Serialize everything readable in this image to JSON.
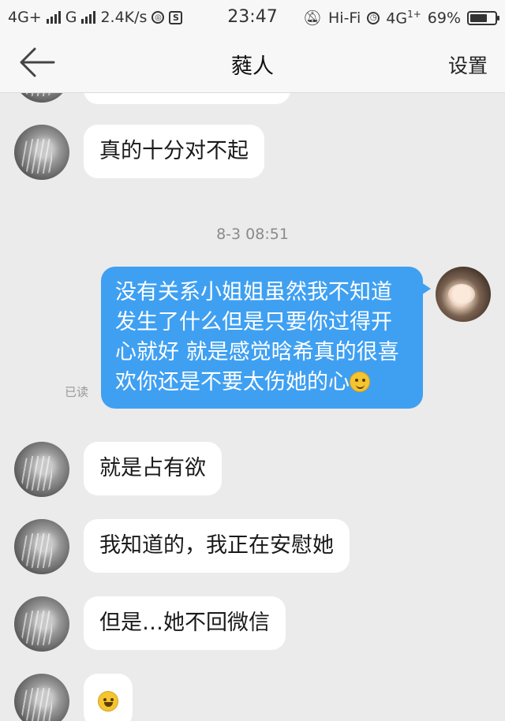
{
  "status_bar": {
    "net1": "4G+",
    "net2": "G",
    "speed": "2.4K/s",
    "time": "23:47",
    "wifi": "Hi-Fi",
    "net3": "4G",
    "net3_sup": "1+",
    "battery": "69%",
    "battery_level": 0.69
  },
  "header": {
    "back_icon": "arrow-left-icon",
    "title": "蕤人",
    "settings_label": "设置"
  },
  "messages": [
    {
      "side": "left",
      "text": ""
    },
    {
      "side": "left",
      "text": "真的十分对不起"
    },
    {
      "type": "timestamp",
      "text": "8-3 08:51"
    },
    {
      "side": "right",
      "text": "没有关系小姐姐虽然我不知道发生了什么但是只要你过得开心就好 就是感觉晗希真的很喜欢你还是不要太伤她的心",
      "read": "已读",
      "emoji": "sweat-smile-emoji"
    },
    {
      "side": "left",
      "text": "就是占有欲"
    },
    {
      "side": "left",
      "text": "我知道的，我正在安慰她"
    },
    {
      "side": "left",
      "text": "但是…她不回微信"
    },
    {
      "side": "left",
      "text": "",
      "emoji": "laughing-tears-emoji"
    }
  ]
}
